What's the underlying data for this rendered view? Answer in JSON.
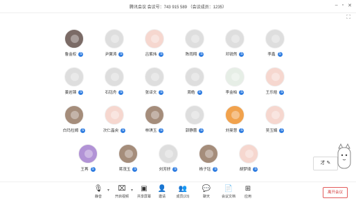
{
  "window": {
    "title": "腾讯会议 会议号：743 915 589 （会议成员：1235）",
    "controls": {
      "minimize": "–",
      "maximize": "▫",
      "close": "✕"
    },
    "fullscreen": "⛶"
  },
  "participants": [
    {
      "name": "鲁金权",
      "badge": "S"
    },
    {
      "name": "尹翼涛",
      "badge": "S"
    },
    {
      "name": "吕紫炜",
      "badge": "S"
    },
    {
      "name": "陈雨翔",
      "badge": "S"
    },
    {
      "name": "邓锐然",
      "badge": "S"
    },
    {
      "name": "李鑫",
      "badge": "S"
    },
    {
      "name": "姜岩锦",
      "badge": "S"
    },
    {
      "name": "石钰舟",
      "badge": "S"
    },
    {
      "name": "张译文",
      "badge": "S"
    },
    {
      "name": "周皓",
      "badge": "S"
    },
    {
      "name": "李金柏",
      "badge": "S"
    },
    {
      "name": "王乐晗",
      "badge": "S"
    },
    {
      "name": "白玛拉姆",
      "badge": "S"
    },
    {
      "name": "次仁晶央",
      "badge": "S"
    },
    {
      "name": "林琪玉",
      "badge": "S"
    },
    {
      "name": "郭静蕾",
      "badge": "S"
    },
    {
      "name": "刘曼慧",
      "badge": "S"
    },
    {
      "name": "吴玉娟",
      "badge": "S"
    },
    {
      "name": "王苒",
      "badge": "S"
    },
    {
      "name": "蒋茂玉",
      "badge": "S"
    },
    {
      "name": "刘芳妤",
      "badge": "S"
    },
    {
      "name": "杨子钰",
      "badge": "S"
    },
    {
      "name": "胡梦琦",
      "badge": "S"
    }
  ],
  "toolbar": {
    "mute": "静音",
    "video": "开启视频",
    "share": "共享屏幕",
    "invite": "邀请",
    "members": "成员(23)",
    "chat": "聊天",
    "docs": "会议文档",
    "apps": "应用",
    "leave": "离开会议"
  },
  "mascot": {
    "bubble": "才 ✎"
  }
}
